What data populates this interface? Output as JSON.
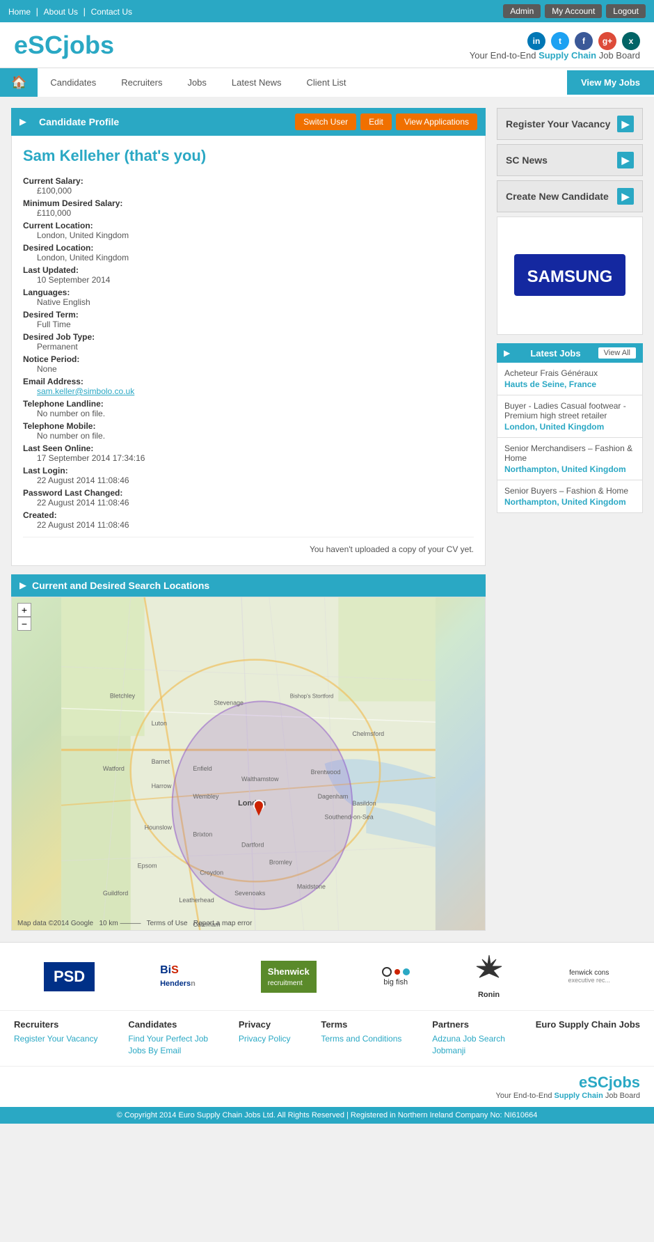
{
  "topbar": {
    "nav_links": [
      "Home",
      "About Us",
      "Contact Us"
    ],
    "nav_separators": [
      "|",
      "|"
    ],
    "buttons": [
      "Admin",
      "My Account",
      "Logout"
    ]
  },
  "header": {
    "logo_text_esc": "eSC",
    "logo_text_jobs": "jobs",
    "tagline_prefix": "Your End-to-End ",
    "tagline_bold": "Supply Chain",
    "tagline_suffix": " Job Board",
    "social": [
      {
        "name": "linkedin",
        "label": "in"
      },
      {
        "name": "twitter",
        "label": "t"
      },
      {
        "name": "facebook",
        "label": "f"
      },
      {
        "name": "google",
        "label": "g+"
      },
      {
        "name": "xing",
        "label": "x"
      }
    ]
  },
  "nav": {
    "home_icon": "🏠",
    "items": [
      "Candidates",
      "Recruiters",
      "Jobs",
      "Latest News",
      "Client List"
    ],
    "cta": "View My Jobs"
  },
  "profile_section": {
    "title": "Candidate Profile",
    "btn_switch": "Switch User",
    "btn_edit": "Edit",
    "btn_view_apps": "View Applications",
    "candidate_name": "Sam Kelleher (that's you)",
    "fields": [
      {
        "label": "Current Salary:",
        "value": "£100,000"
      },
      {
        "label": "Minimum Desired Salary:",
        "value": "£110,000"
      },
      {
        "label": "Current Location:",
        "value": "London, United Kingdom"
      },
      {
        "label": "Desired Location:",
        "value": "London, United Kingdom"
      },
      {
        "label": "Last Updated:",
        "value": "10 September 2014"
      },
      {
        "label": "Languages:",
        "value": "Native English"
      },
      {
        "label": "Desired Term:",
        "value": "Full Time"
      },
      {
        "label": "Desired Job Type:",
        "value": "Permanent"
      },
      {
        "label": "Notice Period:",
        "value": "None"
      },
      {
        "label": "Email Address:",
        "value": "sam.keller@simbolo.co.uk",
        "is_link": true
      },
      {
        "label": "Telephone Landline:",
        "value": "No number on file."
      },
      {
        "label": "Telephone Mobile:",
        "value": "No number on file."
      },
      {
        "label": "Last Seen Online:",
        "value": "17 September 2014 17:34:16"
      },
      {
        "label": "Last Login:",
        "value": "22 August 2014 11:08:46"
      },
      {
        "label": "Password Last Changed:",
        "value": "22 August 2014 11:08:46"
      },
      {
        "label": "Created:",
        "value": "22 August 2014 11:08:46"
      }
    ],
    "cv_notice": "You haven't uploaded a copy of your CV yet."
  },
  "locations_section": {
    "title": "Current and Desired Search Locations",
    "map_attribution": "Map data ©2014 Google",
    "map_scale": "10 km",
    "map_report": "Report a map error",
    "map_terms": "Terms of Use"
  },
  "right_col": {
    "register_vacancy": "Register Your Vacancy",
    "sc_news": "SC News",
    "create_candidate": "Create New Candidate",
    "samsung_alt": "Samsung",
    "latest_jobs_title": "Latest Jobs",
    "view_all": "View All",
    "jobs": [
      {
        "title": "Acheteur Frais Généraux",
        "location": "Hauts de Seine, France"
      },
      {
        "title": "Buyer - Ladies Casual footwear - Premium high street retailer",
        "location": "London, United Kingdom"
      },
      {
        "title": "Senior Merchandisers – Fashion & Home",
        "location": "Northampton, United Kingdom"
      },
      {
        "title": "Senior Buyers – Fashion & Home",
        "location": "Northampton, United Kingdom"
      }
    ]
  },
  "footer_logos": [
    {
      "name": "PSD",
      "style": "psd"
    },
    {
      "name": "BiS Henderson",
      "style": "bis"
    },
    {
      "name": "Shenwick",
      "style": "shenwick"
    },
    {
      "name": "big fish",
      "style": "bigfish"
    },
    {
      "name": "Ronin",
      "style": "ronin"
    },
    {
      "name": "fenwick cons",
      "style": "fenwick"
    }
  ],
  "footer_links": {
    "cols": [
      {
        "title": "Recruiters",
        "links": [
          "Register Your Vacancy"
        ]
      },
      {
        "title": "Candidates",
        "links": [
          "Find Your Perfect Job",
          "Jobs By Email"
        ]
      },
      {
        "title": "Privacy",
        "links": [
          "Privacy Policy"
        ]
      },
      {
        "title": "Terms",
        "links": [
          "Terms and Conditions"
        ]
      },
      {
        "title": "Partners",
        "links": [
          "Adzuna Job Search",
          "Jobmanji"
        ]
      },
      {
        "title": "Euro Supply Chain Jobs",
        "links": []
      }
    ]
  },
  "footer_bottom": {
    "logo_esc": "eSC",
    "logo_jobs": "jobs",
    "tagline_prefix": "Your End-to-End ",
    "tagline_bold": "Supply Chain",
    "tagline_suffix": " Job Board"
  },
  "copyright": {
    "text": "© Copyright 2014 Euro Supply Chain Jobs Ltd. All Rights Reserved | Registered in Northern Ireland Company No: NI610664"
  }
}
